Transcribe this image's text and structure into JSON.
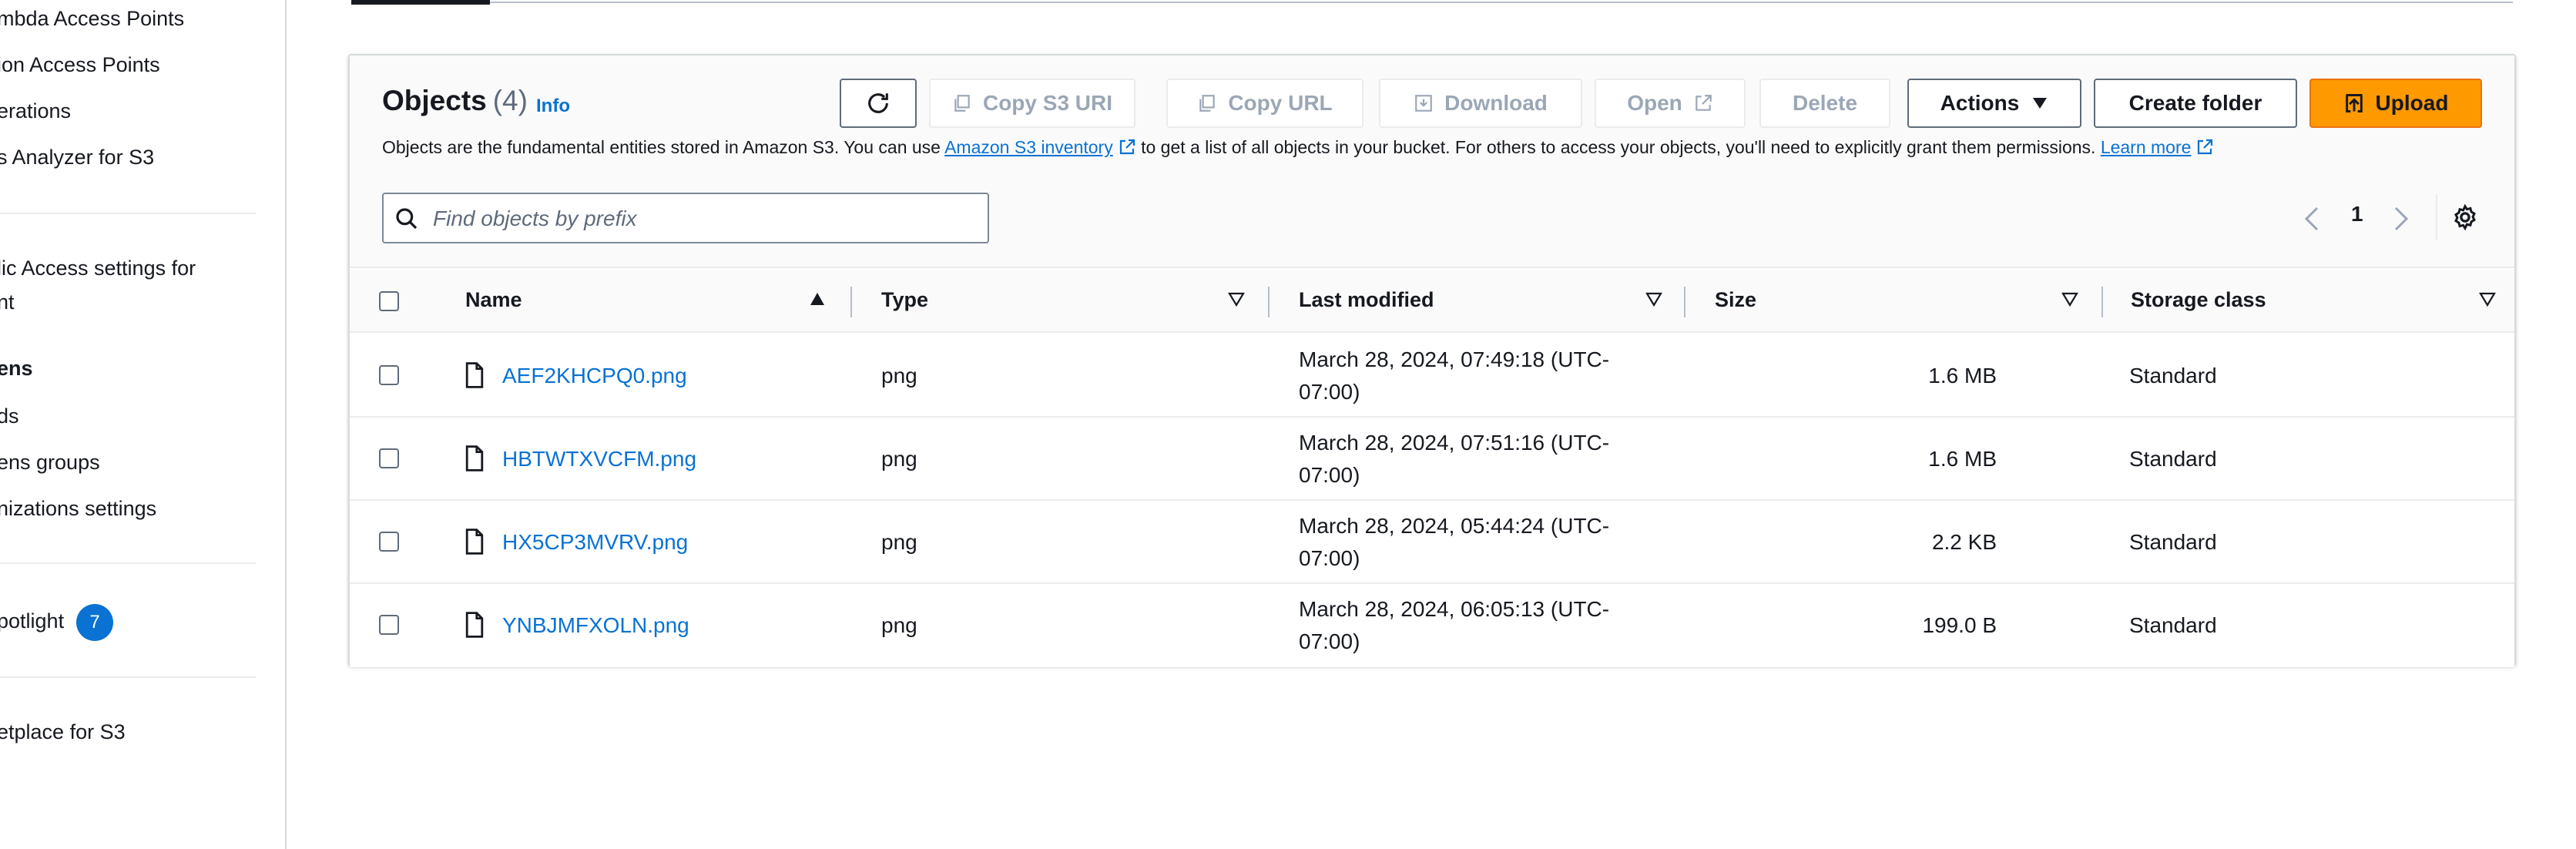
{
  "sidebar": {
    "items": [
      {
        "label": "mbda Access Points"
      },
      {
        "label": "ion Access Points"
      },
      {
        "label": "erations"
      },
      {
        "label": "s Analyzer for S3"
      },
      {
        "label": "lic Access settings for"
      },
      {
        "label": "nt"
      },
      {
        "label": "ens"
      },
      {
        "label": "ds"
      },
      {
        "label": "ens groups"
      },
      {
        "label": "nizations settings"
      },
      {
        "label": "potlight"
      },
      {
        "label": "etplace for S3"
      }
    ],
    "badge": "7"
  },
  "objects": {
    "title": "Objects",
    "count": "(4)",
    "info": "Info",
    "description_1": "Objects are the fundamental entities stored in Amazon S3. You can use ",
    "inventory_link": "Amazon S3 inventory",
    "description_2": " to get a list of all objects in your bucket. For others to access your objects, you'll need to explicitly grant them permissions. ",
    "learn_more": "Learn more",
    "toolbar": {
      "copy_s3_uri": "Copy S3 URI",
      "copy_url": "Copy URL",
      "download": "Download",
      "open": "Open",
      "delete": "Delete",
      "actions": "Actions",
      "create_folder": "Create folder",
      "upload": "Upload"
    },
    "search_placeholder": "Find objects by prefix",
    "page": "1",
    "columns": {
      "name": "Name",
      "type": "Type",
      "last_modified": "Last modified",
      "size": "Size",
      "storage_class": "Storage class"
    },
    "rows": [
      {
        "name": "AEF2KHCPQ0.png",
        "type": "png",
        "modified": "March 28, 2024, 07:49:18 (UTC-07:00)",
        "size": "1.6 MB",
        "storage": "Standard"
      },
      {
        "name": "HBTWTXVCFM.png",
        "type": "png",
        "modified": "March 28, 2024, 07:51:16 (UTC-07:00)",
        "size": "1.6 MB",
        "storage": "Standard"
      },
      {
        "name": "HX5CP3MVRV.png",
        "type": "png",
        "modified": "March 28, 2024, 05:44:24 (UTC-07:00)",
        "size": "2.2 KB",
        "storage": "Standard"
      },
      {
        "name": "YNBJMFXOLN.png",
        "type": "png",
        "modified": "March 28, 2024, 06:05:13 (UTC-07:00)",
        "size": "199.0 B",
        "storage": "Standard"
      }
    ]
  },
  "colors": {
    "accent": "#0972d3",
    "upload": "#ff9900",
    "text": "#16191f",
    "disabled": "#9ba7b6"
  }
}
